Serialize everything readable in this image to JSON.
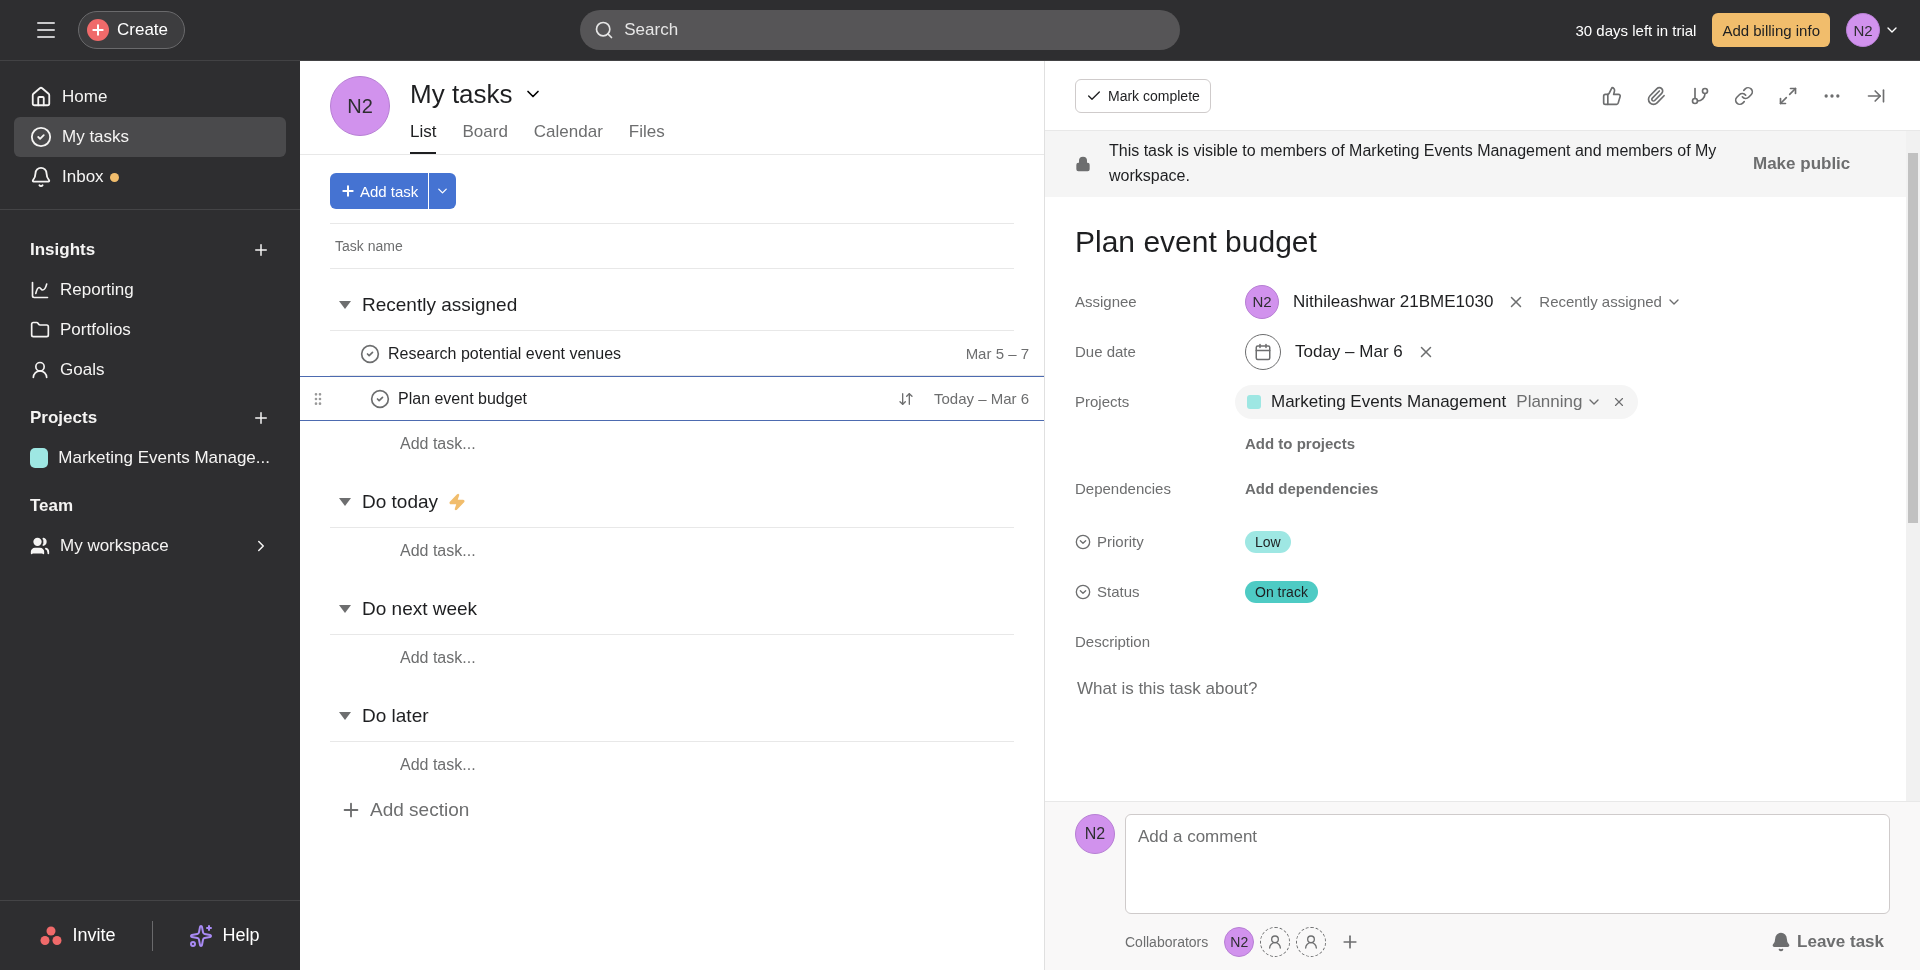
{
  "topbar": {
    "create": "Create",
    "search": {
      "placeholder": "Search"
    },
    "trial": "30 days left in trial",
    "billing": "Add billing info",
    "avatar": "N2"
  },
  "sidebar": {
    "nav": [
      {
        "label": "Home",
        "selected": false,
        "unread": false
      },
      {
        "label": "My tasks",
        "selected": true,
        "unread": false
      },
      {
        "label": "Inbox",
        "selected": false,
        "unread": true
      }
    ],
    "sections": [
      {
        "title": "Insights",
        "addable": true,
        "items": [
          {
            "label": "Reporting",
            "arrow": false
          },
          {
            "label": "Portfolios",
            "arrow": false
          },
          {
            "label": "Goals",
            "arrow": false
          }
        ]
      },
      {
        "title": "Projects",
        "addable": true,
        "items": [
          {
            "label": "Marketing Events Manage...",
            "color": "#9ee7e3",
            "arrow": false
          }
        ]
      },
      {
        "title": "Team",
        "addable": false,
        "items": [
          {
            "label": "My workspace",
            "arrow": true
          }
        ]
      }
    ],
    "footer": {
      "invite": "Invite",
      "help": "Help"
    }
  },
  "main": {
    "avatar": "N2",
    "title": "My tasks",
    "tabs": [
      {
        "label": "List",
        "selected": true
      },
      {
        "label": "Board",
        "selected": false
      },
      {
        "label": "Calendar",
        "selected": false
      },
      {
        "label": "Files",
        "selected": false
      }
    ],
    "add_task": "Add task",
    "column": "Task name",
    "sections": [
      {
        "title": "Recently assigned",
        "bolt": false,
        "tasks": [
          {
            "name": "Research potential event venues",
            "date": "Mar 5 – 7",
            "selected": false
          },
          {
            "name": "Plan event budget",
            "date": "Today – Mar 6",
            "selected": true
          }
        ],
        "add_placeholder": "Add task..."
      },
      {
        "title": "Do today",
        "bolt": true,
        "add_placeholder": "Add task..."
      },
      {
        "title": "Do next week",
        "bolt": false,
        "add_placeholder": "Add task..."
      },
      {
        "title": "Do later",
        "bolt": false,
        "add_placeholder": "Add task..."
      }
    ],
    "add_section": "Add section"
  },
  "detail": {
    "mark_complete": "Mark complete",
    "notice": "This task is visible to members of Marketing Events Management and members of My workspace.",
    "make_public": "Make public",
    "title": "Plan event budget",
    "assignee": {
      "label": "Assignee",
      "avatar": "N2",
      "name": "Nithileashwar 21BME1030",
      "section": "Recently assigned"
    },
    "due_date": {
      "label": "Due date",
      "value": "Today – Mar 6"
    },
    "projects": {
      "label": "Projects",
      "name": "Marketing Events Management",
      "color": "#9ee7e3",
      "section": "Planning",
      "add": "Add to projects"
    },
    "dependencies": {
      "label": "Dependencies",
      "add": "Add dependencies"
    },
    "custom_fields": [
      {
        "label": "Priority",
        "value": "Low",
        "color": "#9ee7e3"
      },
      {
        "label": "Status",
        "value": "On track",
        "color": "#4ecbc4"
      }
    ],
    "description": {
      "label": "Description",
      "placeholder": "What is this task about?"
    },
    "comment": {
      "avatar": "N2",
      "placeholder": "Add a comment"
    },
    "collaborators": {
      "label": "Collaborators",
      "avatar": "N2"
    },
    "leave": "Leave task"
  }
}
